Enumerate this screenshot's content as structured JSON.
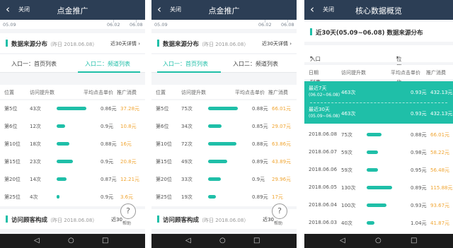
{
  "colors": {
    "accent": "#1fbfa8",
    "header": "#2c3e55",
    "value": "#f0a532"
  },
  "icons": {
    "back": "chevron-left-icon",
    "help": "question-icon",
    "nav_back": "triangle-back-icon",
    "nav_home": "circle-home-icon",
    "nav_recent": "square-recent-icon"
  },
  "p1": {
    "close": "关闭",
    "title": "点金推广",
    "timeline": {
      "start": "05.09",
      "mid": "06.02",
      "end": "06.08"
    },
    "section": {
      "name": "数据来源分布",
      "date": "（昨日 2018.06.08）",
      "more": "近30天详情"
    },
    "tabs": [
      "入口一：首页列表",
      "入口二：频道列表"
    ],
    "cols": {
      "pos": "位置",
      "lift": "访问提升数",
      "price": "平均点击单价",
      "spend": "推广消费"
    },
    "rows": [
      {
        "pos": "第5位",
        "lift": "43次",
        "ratio": 1.0,
        "price": "0.86元",
        "spend": "37.28元"
      },
      {
        "pos": "第6位",
        "lift": "12次",
        "ratio": 0.28,
        "price": "0.9元",
        "spend": "10.8元"
      },
      {
        "pos": "第10位",
        "lift": "18次",
        "ratio": 0.42,
        "price": "0.88元",
        "spend": "16元"
      },
      {
        "pos": "第15位",
        "lift": "23次",
        "ratio": 0.55,
        "price": "0.9元",
        "spend": "20.8元"
      },
      {
        "pos": "第20位",
        "lift": "14次",
        "ratio": 0.33,
        "price": "0.87元",
        "spend": "12.21元"
      },
      {
        "pos": "第25位",
        "lift": "4次",
        "ratio": 0.1,
        "price": "0.9元",
        "spend": "3.6元"
      }
    ],
    "section2": {
      "name": "访问顾客构成",
      "date": "（昨日 2018.06.08）",
      "more": "近30"
    },
    "help": "帮助"
  },
  "p2": {
    "close": "关闭",
    "title": "点金推广",
    "timeline": {
      "start": "05.09",
      "mid": "06.02",
      "end": "06.08"
    },
    "section": {
      "name": "数据来源分布",
      "date": "（昨日 2018.06.08）",
      "more": "近30天详情"
    },
    "tabs": [
      "入口一：首页列表",
      "入口二：频道列表"
    ],
    "cols": {
      "pos": "位置",
      "lift": "访问提升数",
      "price": "平均点击单价",
      "spend": "推广消费"
    },
    "rows": [
      {
        "pos": "第5位",
        "lift": "75次",
        "ratio": 1.0,
        "price": "0.88元",
        "spend": "66.01元"
      },
      {
        "pos": "第6位",
        "lift": "34次",
        "ratio": 0.45,
        "price": "0.85元",
        "spend": "29.07元"
      },
      {
        "pos": "第10位",
        "lift": "72次",
        "ratio": 0.96,
        "price": "0.88元",
        "spend": "63.86元"
      },
      {
        "pos": "第15位",
        "lift": "49次",
        "ratio": 0.65,
        "price": "0.89元",
        "spend": "43.89元"
      },
      {
        "pos": "第20位",
        "lift": "33次",
        "ratio": 0.44,
        "price": "0.9元",
        "spend": "29.96元"
      },
      {
        "pos": "第25位",
        "lift": "19次",
        "ratio": 0.25,
        "price": "0.89元",
        "spend": "17元"
      }
    ],
    "section2": {
      "name": "访问顾客构成",
      "date": "（昨日 2018.06.08）",
      "more": "近30"
    },
    "help": "帮助"
  },
  "p3": {
    "close": "关闭",
    "title": "核心数据概览",
    "section": {
      "name": "近30天(05.09~06.08) 数据来源分布"
    },
    "filter": {
      "entry": "入口一：首页列表",
      "position": "位置：第5位"
    },
    "cols": {
      "date": "日期",
      "lift": "访问提升数",
      "price": "平均点击单价",
      "spend": "推广消费"
    },
    "highlight": [
      {
        "label": "最近7天",
        "range": "(06.02~06.08)",
        "lift": "463次",
        "price": "0.93元",
        "spend": "432.13元"
      },
      {
        "label": "最近30天",
        "range": "(05.09~06.08)",
        "lift": "463次",
        "price": "0.93元",
        "spend": "432.13元"
      }
    ],
    "rows": [
      {
        "date": "2018.06.08",
        "lift": "75次",
        "ratio": 0.58,
        "price": "0.88元",
        "spend": "66.01元"
      },
      {
        "date": "2018.06.07",
        "lift": "59次",
        "ratio": 0.45,
        "price": "0.98元",
        "spend": "58.22元"
      },
      {
        "date": "2018.06.06",
        "lift": "59次",
        "ratio": 0.45,
        "price": "0.95元",
        "spend": "56.48元"
      },
      {
        "date": "2018.06.05",
        "lift": "130次",
        "ratio": 1.0,
        "price": "0.89元",
        "spend": "115.88元"
      },
      {
        "date": "2018.06.04",
        "lift": "100次",
        "ratio": 0.77,
        "price": "0.93元",
        "spend": "93.67元"
      },
      {
        "date": "2018.06.03",
        "lift": "40次",
        "ratio": 0.31,
        "price": "1.04元",
        "spend": "41.87元"
      }
    ]
  }
}
